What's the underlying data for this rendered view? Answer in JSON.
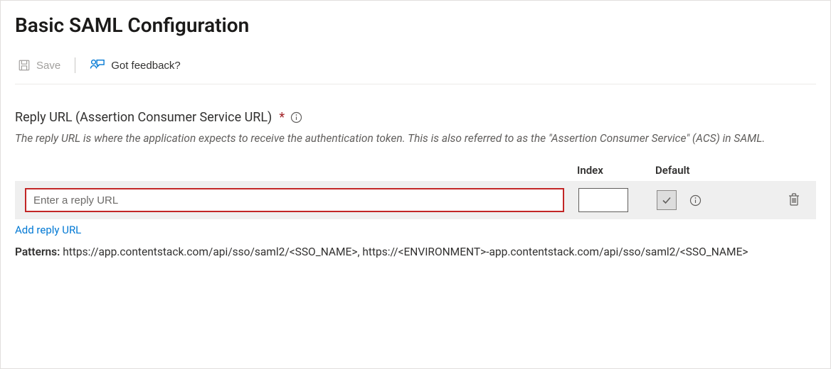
{
  "page": {
    "title": "Basic SAML Configuration"
  },
  "toolbar": {
    "save_label": "Save",
    "feedback_label": "Got feedback?"
  },
  "section": {
    "heading": "Reply URL (Assertion Consumer Service URL)",
    "required_marker": "*",
    "description": "The reply URL is where the application expects to receive the authentication token. This is also referred to as the \"Assertion Consumer Service\" (ACS) in SAML."
  },
  "table": {
    "headers": {
      "url": "",
      "index": "Index",
      "default": "Default"
    },
    "row": {
      "url_value": "",
      "url_placeholder": "Enter a reply URL",
      "index_value": "",
      "default_checked": true
    },
    "add_link_label": "Add reply URL"
  },
  "patterns": {
    "label": "Patterns:",
    "value": "https://app.contentstack.com/api/sso/saml2/<SSO_NAME>, https://<ENVIRONMENT>-app.contentstack.com/api/sso/saml2/<SSO_NAME>"
  }
}
